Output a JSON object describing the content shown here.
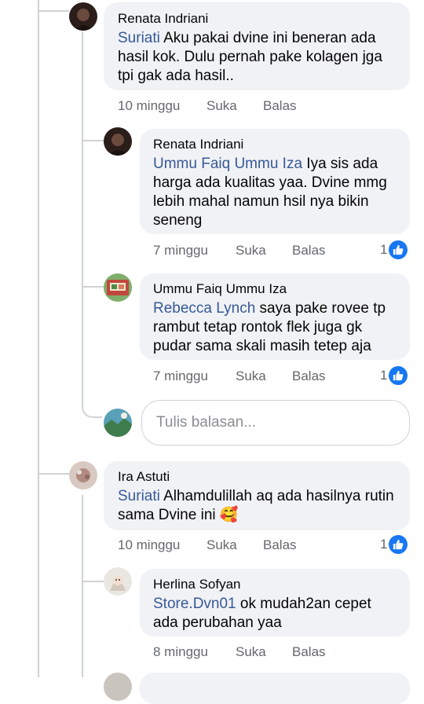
{
  "comments": [
    {
      "author": "Renata Indriani",
      "mention": "Suriati",
      "text": " Aku pakai dvine ini beneran ada hasil kok. Dulu pernah pake kolagen jga tpi gak ada hasil..",
      "time": "10 minggu",
      "like_label": "Suka",
      "reply_label": "Balas",
      "likes": ""
    },
    {
      "author": "Renata Indriani",
      "mention": "Ummu Faiq Ummu Iza",
      "text": " Iya sis ada harga ada kualitas yaa. Dvine mmg lebih mahal namun hsil nya bikin seneng",
      "time": "7 minggu",
      "like_label": "Suka",
      "reply_label": "Balas",
      "likes": "1"
    },
    {
      "author": "Ummu Faiq Ummu Iza",
      "mention": "Rebecca Lynch",
      "text": " saya pake rovee tp rambut tetap rontok flek juga gk pudar sama skali masih tetep aja",
      "time": "7 minggu",
      "like_label": "Suka",
      "reply_label": "Balas",
      "likes": "1"
    },
    {
      "author": "Ira Astuti",
      "mention": "Suriati",
      "text": " Alhamdulillah aq ada hasilnya rutin sama Dvine ini 🥰",
      "time": "10 minggu",
      "like_label": "Suka",
      "reply_label": "Balas",
      "likes": "1"
    },
    {
      "author": "Herlina Sofyan",
      "mention": "Store.Dvn01",
      "text": " ok mudah2an cepet ada perubahan yaa",
      "time": "8 minggu",
      "like_label": "Suka",
      "reply_label": "Balas",
      "likes": ""
    }
  ],
  "reply_box": {
    "placeholder": "Tulis balasan..."
  },
  "colors": {
    "mention": "#385898",
    "like_badge": "#1877f2",
    "bubble": "#f0f2f5",
    "meta_text": "#65676b"
  },
  "icons": {
    "like": "thumbs-up-icon"
  }
}
